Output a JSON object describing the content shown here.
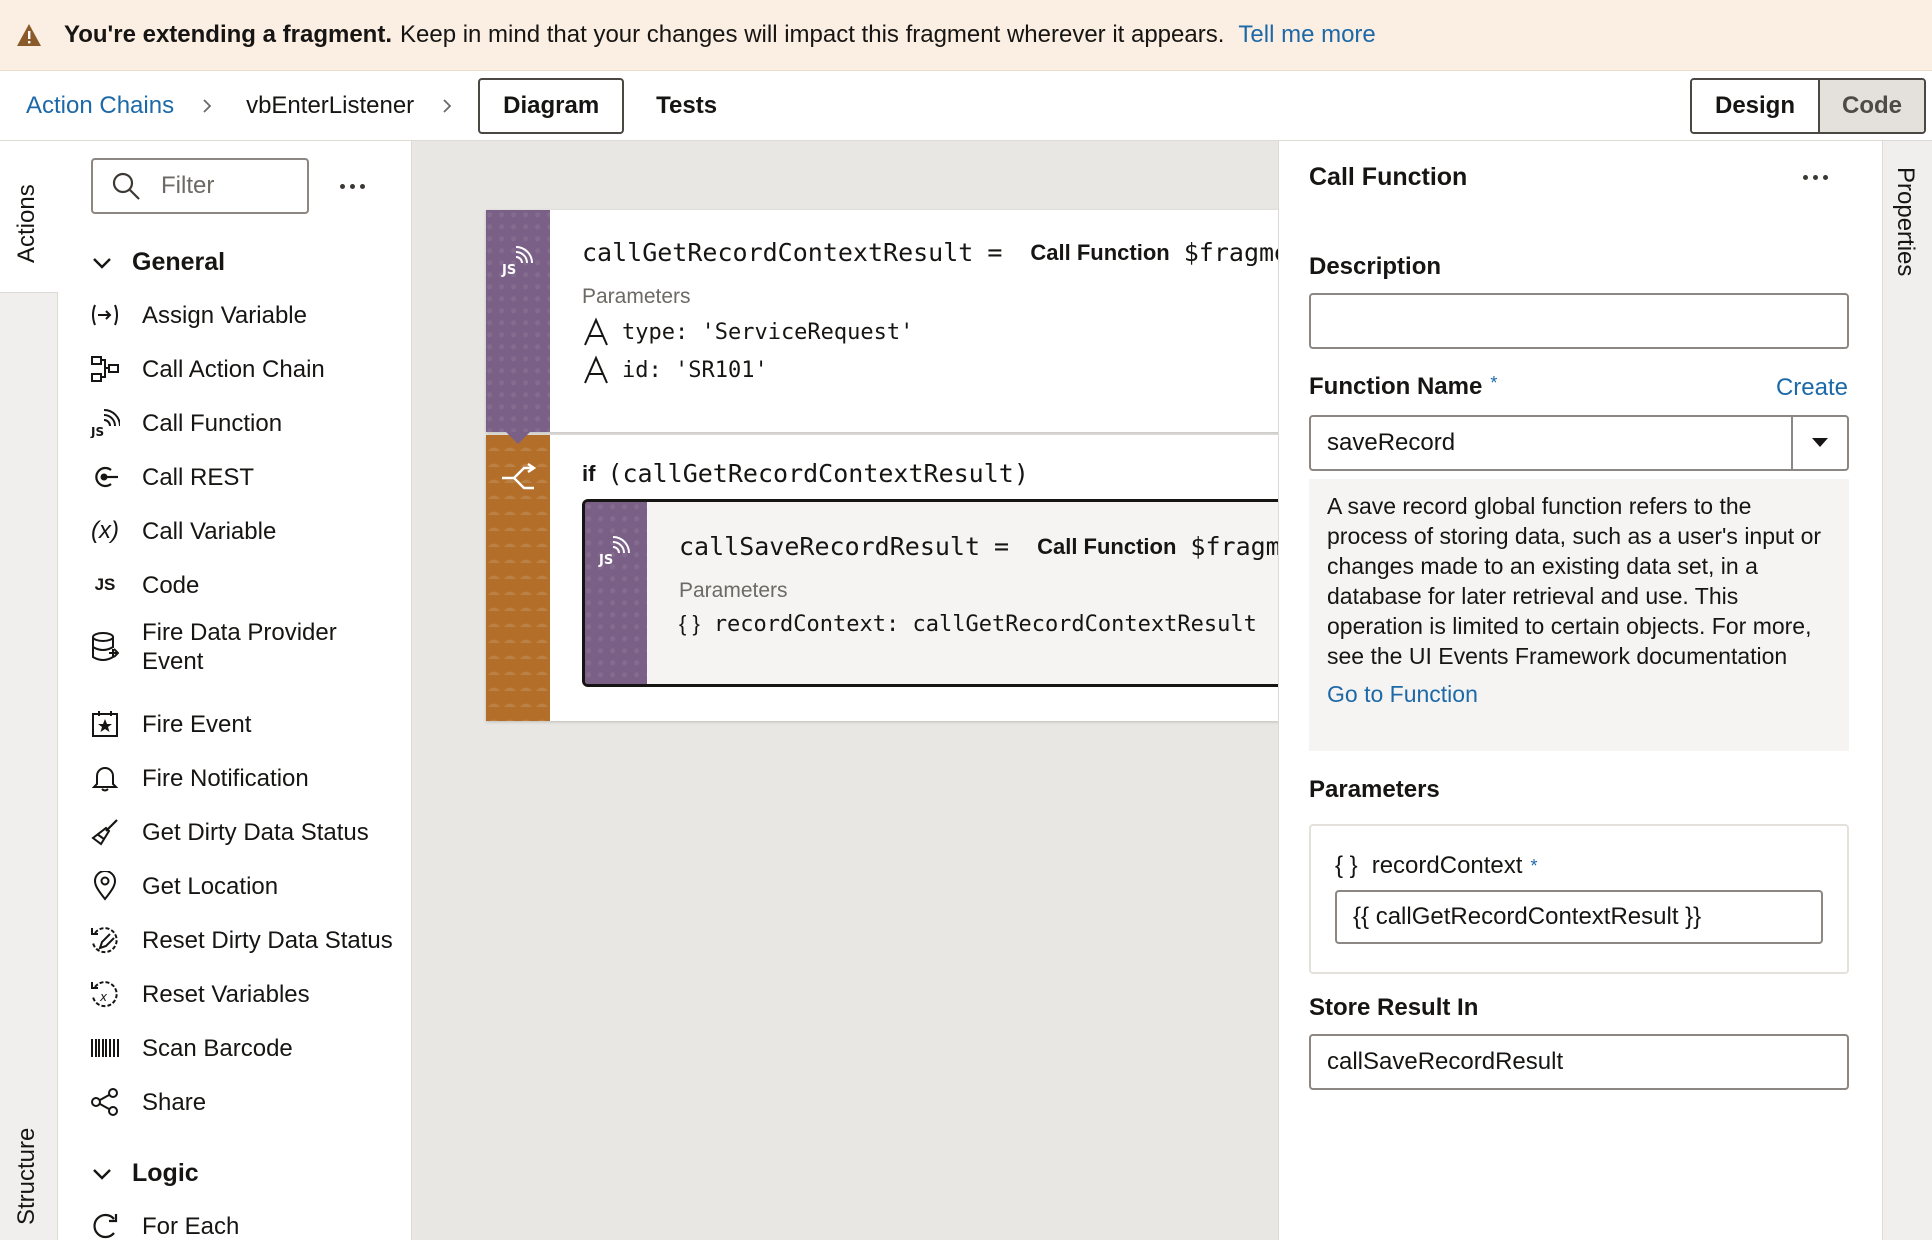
{
  "banner": {
    "bold": "You're extending a fragment.",
    "message": "Keep in mind that your changes will impact this fragment wherever it appears.",
    "link": "Tell me more"
  },
  "breadcrumb": {
    "root": "Action Chains",
    "current": "vbEnterListener"
  },
  "tabs": {
    "diagram": "Diagram",
    "tests": "Tests"
  },
  "mode": {
    "design": "Design",
    "code": "Code"
  },
  "vtabs": {
    "actions": "Actions",
    "structure": "Structure",
    "properties": "Properties"
  },
  "palette": {
    "filter_placeholder": "Filter",
    "general": "General",
    "logic": "Logic",
    "items": [
      {
        "label": "Assign Variable",
        "icon": "assign-variable-icon"
      },
      {
        "label": "Call Action Chain",
        "icon": "call-action-chain-icon"
      },
      {
        "label": "Call Function",
        "icon": "call-function-icon"
      },
      {
        "label": "Call REST",
        "icon": "call-rest-icon"
      },
      {
        "label": "Call Variable",
        "icon": "call-variable-icon"
      },
      {
        "label": "Code",
        "icon": "code-icon"
      },
      {
        "label": "Fire Data Provider Event",
        "icon": "database-icon"
      },
      {
        "label": "Fire Event",
        "icon": "fire-event-icon"
      },
      {
        "label": "Fire Notification",
        "icon": "bell-icon"
      },
      {
        "label": "Get Dirty Data Status",
        "icon": "broom-icon"
      },
      {
        "label": "Get Location",
        "icon": "location-pin-icon"
      },
      {
        "label": "Reset Dirty Data Status",
        "icon": "reset-dirty-icon"
      },
      {
        "label": "Reset Variables",
        "icon": "reset-variables-icon"
      },
      {
        "label": "Scan Barcode",
        "icon": "barcode-icon"
      },
      {
        "label": "Share",
        "icon": "share-icon"
      }
    ],
    "logic_items": [
      {
        "label": "For Each",
        "icon": "for-each-icon"
      }
    ]
  },
  "canvas": {
    "card1": {
      "result_var": "callGetRecordContextResult",
      "op": "=",
      "keyword": "Call Function",
      "target": "$fragment",
      "params_label": "Parameters",
      "param1": "type: 'ServiceRequest'",
      "param2": "id: 'SR101'"
    },
    "card2": {
      "if_keyword": "if",
      "condition": "(callGetRecordContextResult)"
    },
    "inner": {
      "result_var": "callSaveRecordResult",
      "op": "=",
      "keyword": "Call Function",
      "target": "$fragmen",
      "params_label": "Parameters",
      "param_brace": "{ }",
      "param1": "recordContext: callGetRecordContextResult"
    }
  },
  "properties": {
    "title": "Call Function",
    "description_label": "Description",
    "description_value": "",
    "function_name_label": "Function Name",
    "required_mark": "*",
    "create_link": "Create",
    "function_name_value": "saveRecord",
    "function_description": "A save record global function refers to the process of storing data, such as a user's input or changes made to an existing data set, in a database for later retrieval and use. This operation is limited to certain objects. For more, see the UI Events Framework documentation",
    "go_to_function": "Go to Function",
    "parameters_label": "Parameters",
    "param_brace": "{ }",
    "param_name": "recordContext",
    "param_value": "{{ callGetRecordContextResult }}",
    "store_result_label": "Store Result In",
    "store_result_value": "callSaveRecordResult"
  },
  "colors": {
    "link": "#1d69a8",
    "banner_bg": "#fbeee2",
    "function_strip": "#7a5f86",
    "if_strip": "#b36f2a",
    "warning": "#8a5a2b"
  }
}
